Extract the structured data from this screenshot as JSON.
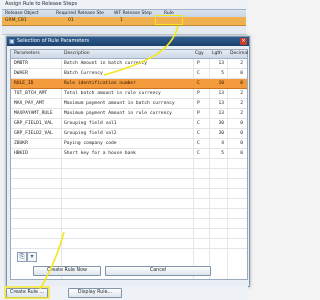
{
  "assign_panel": {
    "title": "Assign Rule to Release Steps",
    "columns": [
      "Release Object",
      "Required Release Ste",
      "WF Release Step",
      "Rule"
    ],
    "row": {
      "release_object": "GRM_CB1",
      "required_release_step": "01",
      "wf_release_step": "1",
      "rule": ""
    }
  },
  "dialog": {
    "title": "Selection of Rule Parameters",
    "columns": [
      "Parameters",
      "Description",
      "Cgy",
      "Lgth",
      "Decimal"
    ],
    "rows": [
      {
        "parameter": "DMBTR",
        "description": "Batch Amount in batch currency",
        "cgy": "P",
        "lgth": "13",
        "decimal": "2"
      },
      {
        "parameter": "DWAER",
        "description": "Batch Currency",
        "cgy": "C",
        "lgth": "5",
        "decimal": "0"
      },
      {
        "parameter": "RULE_ID",
        "description": "Rule identification number",
        "cgy": "C",
        "lgth": "10",
        "decimal": "0",
        "highlighted": true
      },
      {
        "parameter": "TOT_BTCH_AMT",
        "description": "Total batch amount in rule currency",
        "cgy": "P",
        "lgth": "13",
        "decimal": "2"
      },
      {
        "parameter": "MAX_PAY_AMT",
        "description": "Maximum payment amount in batch currency",
        "cgy": "P",
        "lgth": "13",
        "decimal": "2"
      },
      {
        "parameter": "MAXPAYAMT_RULE",
        "description": "Maximum payment Amount in rule currency",
        "cgy": "P",
        "lgth": "13",
        "decimal": "2"
      },
      {
        "parameter": "GRP_FIELD1_VAL",
        "description": "Grouping field val1",
        "cgy": "C",
        "lgth": "30",
        "decimal": "0"
      },
      {
        "parameter": "GRP_FIELD2_VAL",
        "description": "Grouping field val2",
        "cgy": "C",
        "lgth": "30",
        "decimal": "0"
      },
      {
        "parameter": "ZBUKR",
        "description": "Paying company code",
        "cgy": "C",
        "lgth": "4",
        "decimal": "0"
      },
      {
        "parameter": "HBKID",
        "description": "Short key for a house bank",
        "cgy": "C",
        "lgth": "5",
        "decimal": "0"
      }
    ],
    "create_rule_now_label": "Create Rule Now",
    "cancel_label": "Cancel",
    "close_glyph": "×",
    "tools": [
      "⎘",
      "▾"
    ]
  },
  "bottom_bar": {
    "create_rule_label": "Create Rule ...",
    "display_rule_label": "Display Rule..."
  },
  "colors": {
    "highlight": "#f39a3c",
    "annotation": "#f5e61b",
    "titlebar": "#1c416d"
  }
}
